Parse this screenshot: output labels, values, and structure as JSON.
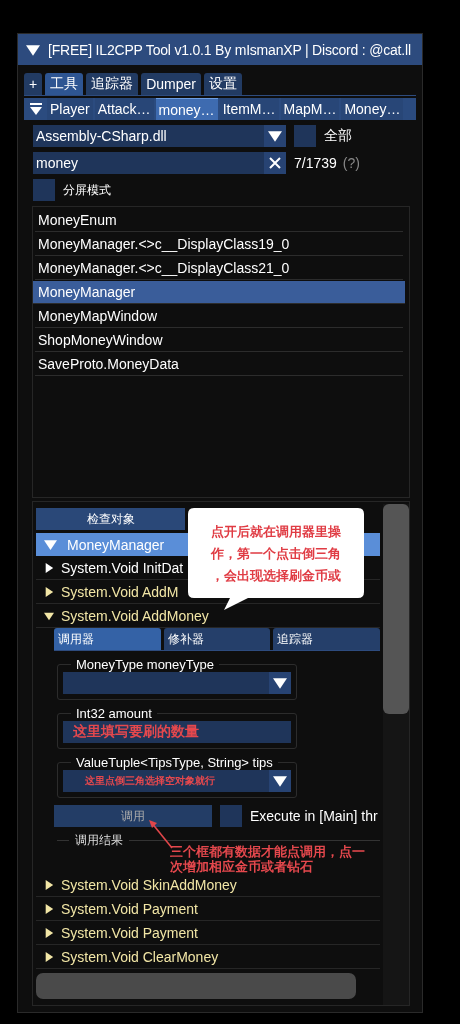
{
  "window": {
    "title": "[FREE] IL2CPP Tool v1.0.1 By mIsmanXP | Discord : @cat.ll",
    "expanded": true
  },
  "main_tabs": [
    {
      "label": "+",
      "selected": false
    },
    {
      "label": "工具",
      "selected": true
    },
    {
      "label": "追踪器",
      "selected": false
    },
    {
      "label": "Dumper",
      "selected": false
    },
    {
      "label": "设置",
      "selected": false
    }
  ],
  "sub_tabs": [
    {
      "label": "Player",
      "selected": false
    },
    {
      "label": "Attack…",
      "selected": false
    },
    {
      "label": "money…",
      "selected": true
    },
    {
      "label": "ItemM…",
      "selected": false
    },
    {
      "label": "MapM…",
      "selected": false
    },
    {
      "label": "Money…",
      "selected": false
    }
  ],
  "assembly_select": {
    "value": "Assembly-CSharp.dll"
  },
  "all_checkbox": {
    "label": "全部",
    "checked": false
  },
  "search": {
    "value": "money",
    "count": "7/1739",
    "help": "(?)"
  },
  "split_mode": {
    "label": "分屏模式",
    "checked": false
  },
  "classes": [
    {
      "name": "MoneyEnum",
      "selected": false
    },
    {
      "name": "MoneyManager.<>c__DisplayClass19_0",
      "selected": false
    },
    {
      "name": "MoneyManager.<>c__DisplayClass21_0",
      "selected": false
    },
    {
      "name": "MoneyManager",
      "selected": true
    },
    {
      "name": "MoneyMapWindow",
      "selected": false
    },
    {
      "name": "ShopMoneyWindow",
      "selected": false
    },
    {
      "name": "SaveProto.MoneyData",
      "selected": false
    }
  ],
  "inspector": {
    "inspect_button": "检查对象",
    "class_header": {
      "name": "MoneyManager",
      "expanded": true
    },
    "methods": [
      {
        "name": "System.Void InitDat",
        "color": "#ffffff",
        "expanded": false
      },
      {
        "name": "System.Void AddM",
        "color": "#f2e6a6",
        "expanded": false
      },
      {
        "name": "System.Void AddMoney",
        "color": "#f2e6a6",
        "expanded": true,
        "invoker": {
          "tabs": [
            {
              "label": "调用器",
              "selected": true
            },
            {
              "label": "修补器",
              "selected": false
            },
            {
              "label": "追踪器",
              "selected": false
            }
          ],
          "params": [
            {
              "label": "MoneyType moneyType",
              "kind": "dropdown"
            },
            {
              "label": "Int32 amount",
              "kind": "input",
              "note": "这里填写要刷的数量"
            },
            {
              "label": "ValueTuple<TipsType, String> tips",
              "kind": "dropdown",
              "note": "这里点倒三角选择空对象就行"
            }
          ],
          "invoke_button": "调用",
          "main_thread": {
            "label": "Execute in [Main] thr",
            "checked": false
          },
          "result_label": "调用结果",
          "note": "三个框都有数据才能点调用，点一次增加相应金币或者钻石"
        }
      },
      {
        "name": "System.Void SkinAddMoney",
        "color": "#f2e6a6",
        "expanded": false
      },
      {
        "name": "System.Void Payment",
        "color": "#f2e6a6",
        "expanded": false
      },
      {
        "name": "System.Void Payment",
        "color": "#f2e6a6",
        "expanded": false
      },
      {
        "name": "System.Void ClearMoney",
        "color": "#f2e6a6",
        "expanded": false
      }
    ],
    "callout": "点开后就在调用器里操作，第一个点击倒三角，会出现选择刷金币或"
  }
}
